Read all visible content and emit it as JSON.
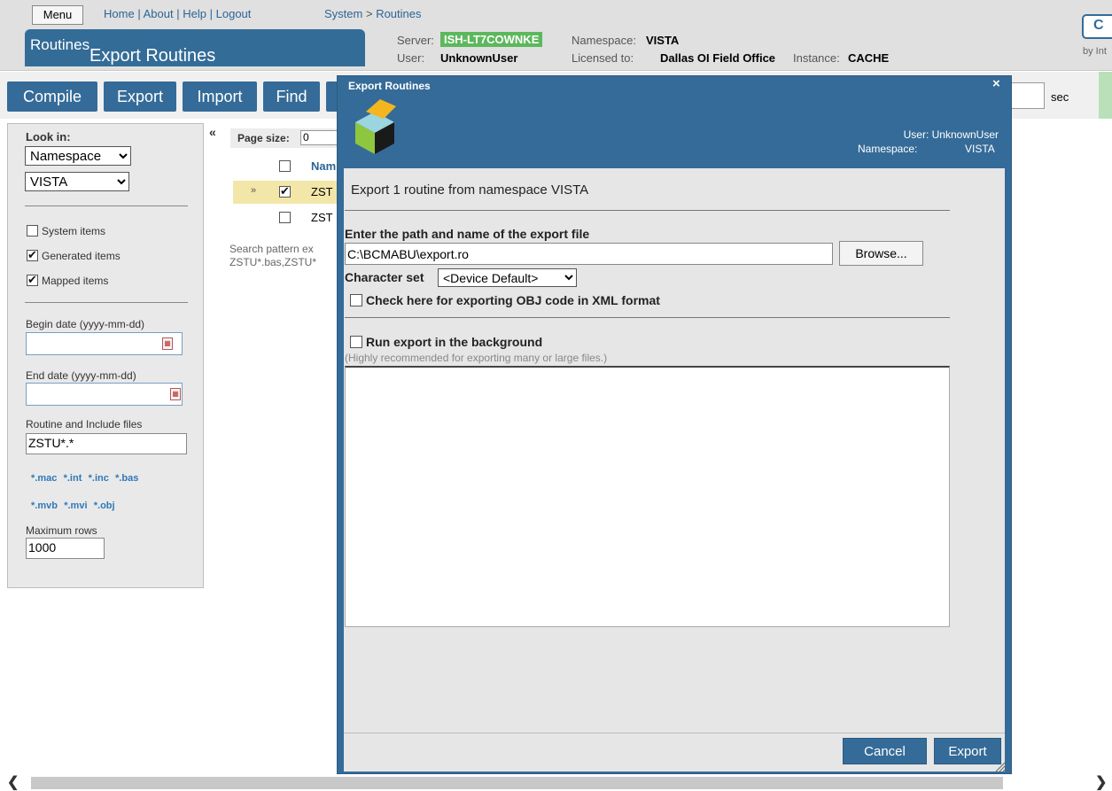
{
  "header": {
    "menu_label": "Menu",
    "nav_links": [
      "Home",
      "About",
      "Help",
      "Logout"
    ],
    "breadcrumb": [
      "System",
      "Routines"
    ],
    "page_title": "Routines",
    "server_label": "Server:",
    "server_value": "ISH-LT7COWNKE",
    "namespace_label": "Namespace:",
    "namespace_value": "VISTA",
    "user_label": "User:",
    "user_value": "UnknownUser",
    "licensed_label": "Licensed to:",
    "licensed_value": "Dallas OI Field Office",
    "instance_label": "Instance:",
    "instance_value": "CACHE",
    "logo_letter": "C",
    "by_text": "by Int"
  },
  "toolbar": {
    "buttons": [
      "Compile",
      "Export",
      "Import",
      "Find"
    ],
    "sec_label": "sec"
  },
  "sidebar": {
    "collapse_glyph": "«",
    "look_in_label": "Look in:",
    "look_in_value": "Namespace",
    "namespace_value": "VISTA",
    "system_items": "System items",
    "generated_items": "Generated items",
    "mapped_items": "Mapped items",
    "begin_date_label": "Begin date (yyyy-mm-dd)",
    "end_date_label": "End date (yyyy-mm-dd)",
    "routine_label": "Routine and Include files",
    "routine_value": "ZSTU*.*",
    "ext_row1": [
      "*.mac",
      "*.int",
      "*.inc",
      "*.bas"
    ],
    "ext_row2": [
      "*.mvb",
      "*.mvi",
      "*.obj"
    ],
    "max_rows_label": "Maximum rows",
    "max_rows_value": "1000"
  },
  "list": {
    "page_size_label": "Page size:",
    "page_size_value": "0",
    "col_name": "Nam",
    "row1": "ZST",
    "row2": "ZST",
    "row_marker": "»",
    "search_line1": "Search pattern ex",
    "search_line2": "ZSTU*.bas,ZSTU*"
  },
  "dialog": {
    "titlebar": "Export Routines",
    "close_glyph": "×",
    "title": "Export Routines",
    "user_line": "User: UnknownUser",
    "namespace_label": "Namespace:",
    "namespace_value": "VISTA",
    "summary": "Export 1 routine from namespace VISTA",
    "path_label": "Enter the path and name of the export file",
    "path_value": "C:\\BCMABU\\export.ro",
    "browse": "Browse...",
    "charset_label": "Character set",
    "charset_value": "<Device Default>",
    "xml_check": "Check here for exporting OBJ code in XML format",
    "bg_check": "Run export in the background",
    "bg_hint": "(Highly recommended for exporting many or large files.)",
    "cancel": "Cancel",
    "export": "Export"
  }
}
